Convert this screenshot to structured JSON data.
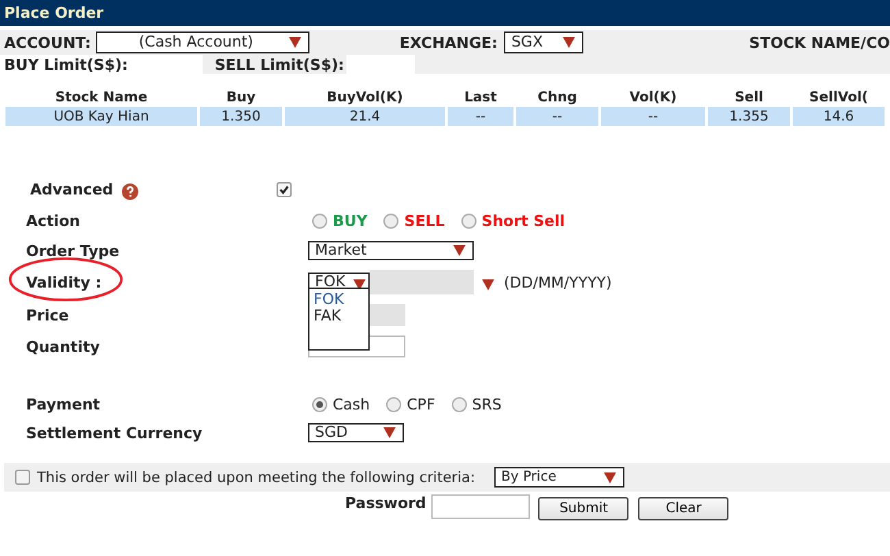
{
  "window": {
    "title": "Place Order"
  },
  "header": {
    "account": {
      "label": "ACCOUNT:",
      "value": "(Cash Account)"
    },
    "exchange": {
      "label": "EXCHANGE:",
      "value": "SGX"
    },
    "stock_label": "STOCK NAME/CO",
    "buy_limit": "BUY Limit(S$):",
    "sell_limit": "SELL Limit(S$):"
  },
  "table": {
    "columns": [
      "Stock Name",
      "Buy",
      "BuyVol(K)",
      "Last",
      "Chng",
      "Vol(K)",
      "Sell",
      "SellVol("
    ],
    "rows": [
      [
        "UOB Kay Hian",
        "1.350",
        "21.4",
        "--",
        "--",
        "--",
        "1.355",
        "14.6"
      ]
    ]
  },
  "form": {
    "advanced": {
      "label": "Advanced",
      "checked": true
    },
    "action": {
      "label": "Action",
      "options": [
        {
          "label": "BUY",
          "selected": false,
          "color": "#1a9a4a"
        },
        {
          "label": "SELL",
          "selected": false,
          "color": "#ee1111"
        },
        {
          "label": "Short Sell",
          "selected": false,
          "color": "#ee1111"
        }
      ]
    },
    "order_type": {
      "label": "Order Type",
      "value": "Market"
    },
    "validity": {
      "label": "Validity :",
      "value": "FOK",
      "date_hint": "(DD/MM/YYYY)",
      "options": [
        {
          "label": "FOK",
          "selected": true
        },
        {
          "label": "FAK",
          "selected": false
        }
      ]
    },
    "price": {
      "label": "Price"
    },
    "quantity": {
      "label": "Quantity"
    },
    "payment": {
      "label": "Payment",
      "options": [
        {
          "label": "Cash",
          "selected": true
        },
        {
          "label": "CPF",
          "selected": false
        },
        {
          "label": "SRS",
          "selected": false
        }
      ]
    },
    "currency": {
      "label": "Settlement Currency",
      "value": "SGD"
    }
  },
  "criteria": {
    "checked": false,
    "label": "This order will be placed upon meeting the following criteria:",
    "value": "By Price"
  },
  "password": {
    "label": "Password"
  },
  "buttons": [
    "Submit",
    "Clear"
  ]
}
